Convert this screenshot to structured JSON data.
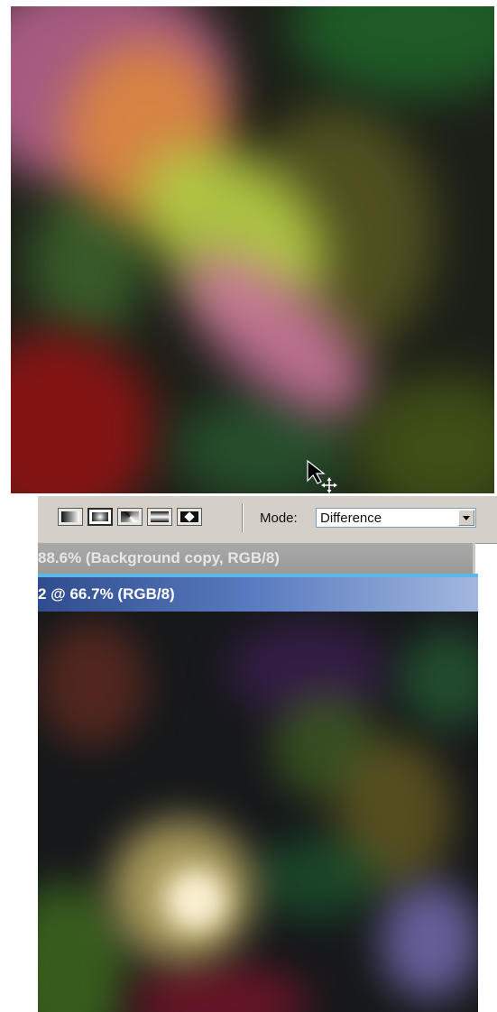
{
  "options_bar": {
    "gradient_types": [
      "linear-gradient-icon",
      "radial-gradient-icon",
      "angle-gradient-icon",
      "reflected-gradient-icon",
      "diamond-gradient-icon"
    ],
    "selected_gradient": "radial-gradient-icon",
    "mode_label": "Mode:",
    "mode_value": "Difference"
  },
  "documents": {
    "inactive_title": "88.6% (Background copy, RGB/8)",
    "active_title": "2 @ 66.7% (RGB/8)"
  },
  "colors": {
    "active_titlebar": "#2f4c8e",
    "inactive_titlebar": "#9a9a9a",
    "options_bar_bg": "#d4d0c8"
  }
}
